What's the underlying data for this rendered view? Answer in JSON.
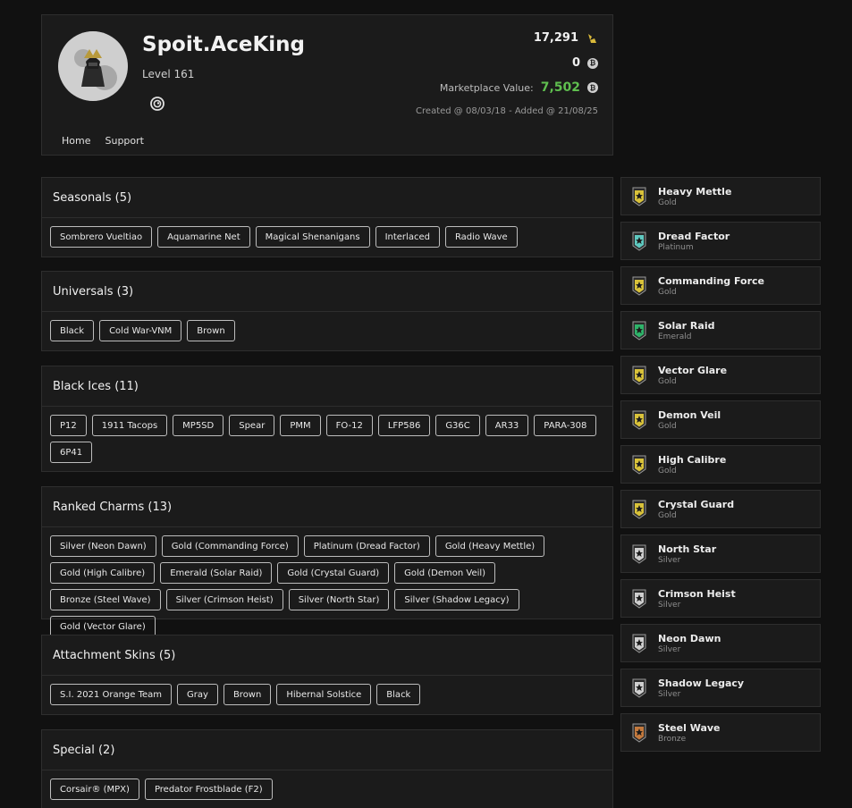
{
  "profile": {
    "username": "Spoit.AceKing",
    "level": "Level 161",
    "credits": "17,291",
    "coins": "0",
    "marketplace_label": "Marketplace Value:",
    "marketplace_value": "7,502",
    "created": "Created @ 08/03/18 - Added @ 21/08/25",
    "nav": [
      "Home",
      "Support"
    ],
    "accent_green": "#5fbf4f",
    "credit_icon": "credits-icon",
    "coin_icon": "coin-icon",
    "platform_icon": "ubisoft-icon"
  },
  "sections": [
    {
      "title": "Seasonals (5)",
      "items": [
        "Sombrero Vueltiao",
        "Aquamarine Net",
        "Magical Shenanigans",
        "Interlaced",
        "Radio Wave"
      ]
    },
    {
      "title": "Universals (3)",
      "items": [
        "Black",
        "Cold War-VNM",
        "Brown"
      ]
    },
    {
      "title": "Black Ices (11)",
      "items": [
        "P12",
        "1911 Tacops",
        "MP5SD",
        "Spear",
        "PMM",
        "FO-12",
        "LFP586",
        "G36C",
        "AR33",
        "PARA-308",
        "6P41"
      ]
    },
    {
      "title": "Ranked Charms (13)",
      "items": [
        "Silver (Neon Dawn)",
        "Gold (Commanding Force)",
        "Platinum (Dread Factor)",
        "Gold (Heavy Mettle)",
        "Gold (High Calibre)",
        "Emerald (Solar Raid)",
        "Gold (Crystal Guard)",
        "Gold (Demon Veil)",
        "Bronze (Steel Wave)",
        "Silver (Crimson Heist)",
        "Silver (North Star)",
        "Silver (Shadow Legacy)",
        "Gold (Vector Glare)"
      ]
    },
    {
      "title": "Attachment Skins (5)",
      "items": [
        "S.I. 2021 Orange Team",
        "Gray",
        "Brown",
        "Hibernal Solstice",
        "Black"
      ]
    },
    {
      "title": "Special (2)",
      "items": [
        "Corsair® (MPX)",
        "Predator Frostblade (F2)"
      ]
    }
  ],
  "charms": [
    {
      "name": "Heavy Mettle",
      "tier": "Gold",
      "color": "#d9c23a"
    },
    {
      "name": "Dread Factor",
      "tier": "Platinum",
      "color": "#5fc9c0"
    },
    {
      "name": "Commanding Force",
      "tier": "Gold",
      "color": "#d9c23a"
    },
    {
      "name": "Solar Raid",
      "tier": "Emerald",
      "color": "#2fb36a"
    },
    {
      "name": "Vector Glare",
      "tier": "Gold",
      "color": "#d9c23a"
    },
    {
      "name": "Demon Veil",
      "tier": "Gold",
      "color": "#d9c23a"
    },
    {
      "name": "High Calibre",
      "tier": "Gold",
      "color": "#d9c23a"
    },
    {
      "name": "Crystal Guard",
      "tier": "Gold",
      "color": "#d9c23a"
    },
    {
      "name": "North Star",
      "tier": "Silver",
      "color": "#cfcfcf"
    },
    {
      "name": "Crimson Heist",
      "tier": "Silver",
      "color": "#cfcfcf"
    },
    {
      "name": "Neon Dawn",
      "tier": "Silver",
      "color": "#cfcfcf"
    },
    {
      "name": "Shadow Legacy",
      "tier": "Silver",
      "color": "#cfcfcf"
    },
    {
      "name": "Steel Wave",
      "tier": "Bronze",
      "color": "#c47a3e"
    }
  ]
}
